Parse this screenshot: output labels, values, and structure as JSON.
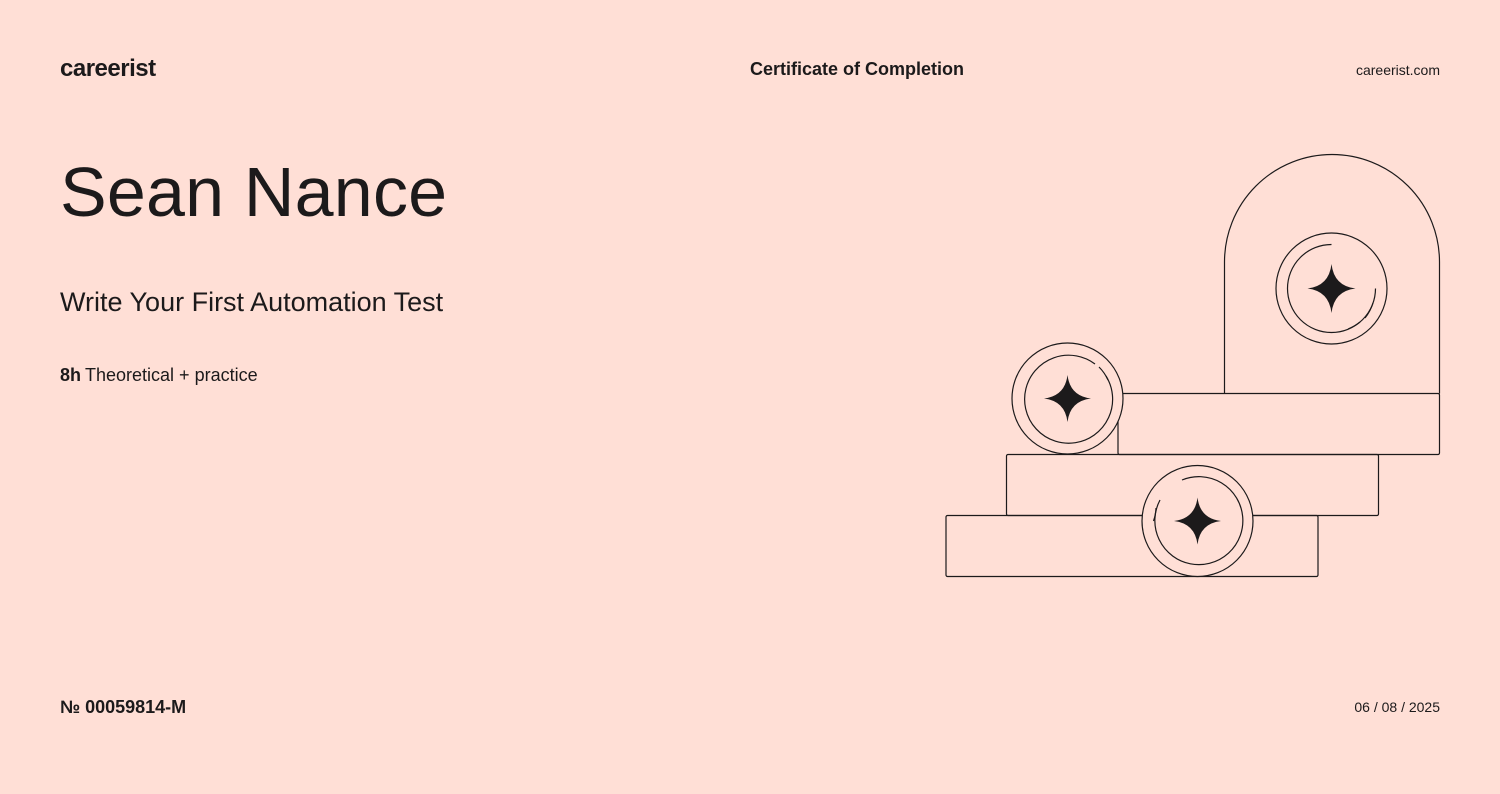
{
  "header": {
    "logo_text": "careerist",
    "certificate_title": "Certificate of Completion",
    "website": "careerist.com"
  },
  "certificate": {
    "recipient_name": "Sean Nance",
    "course_title": "Write Your First Automation Test",
    "duration_hours": "8h",
    "duration_description": "Theoretical + practice",
    "number": "№ 00059814-M",
    "date": "06 / 08 / 2025"
  },
  "colors": {
    "background": "#ffdfd6",
    "ink": "#1c1a1b"
  },
  "illustration": {
    "icon": "stacked-blocks-with-star-coins"
  }
}
